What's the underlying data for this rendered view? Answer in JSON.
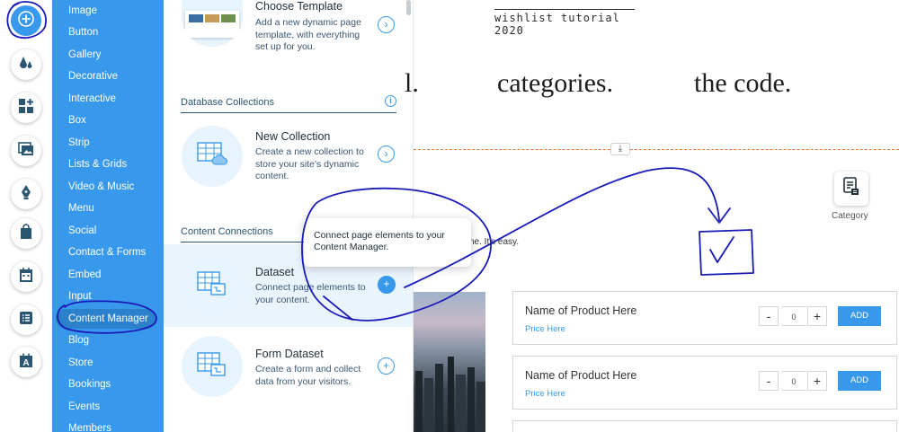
{
  "rail": {
    "buttons": [
      "add-icon",
      "theme-icon",
      "apps-icon",
      "media-icon",
      "pen-icon",
      "store-bag-icon",
      "calendar-icon",
      "list-icon",
      "text-icon"
    ]
  },
  "categories": {
    "items": [
      "Image",
      "Button",
      "Gallery",
      "Decorative",
      "Interactive",
      "Box",
      "Strip",
      "Lists & Grids",
      "Video & Music",
      "Menu",
      "Social",
      "Contact & Forms",
      "Embed",
      "Input",
      "Content Manager",
      "Blog",
      "Store",
      "Bookings",
      "Events",
      "Members"
    ],
    "selected": "Content Manager"
  },
  "panel": {
    "choose_template": {
      "title": "Choose Template",
      "desc": "Add a new dynamic page template, with everything set up for you."
    },
    "database_collections_title": "Database Collections",
    "new_collection": {
      "title": "New Collection",
      "desc": "Create a new collection to store your site's dynamic content."
    },
    "content_connections_title": "Content Connections",
    "dataset": {
      "title": "Dataset",
      "desc": "Connect page elements to your content."
    },
    "form_dataset": {
      "title": "Form Dataset",
      "desc": "Create a form and collect data from your visitors."
    },
    "tooltip": "Connect page elements to your Content Manager."
  },
  "canvas": {
    "header": "wishlist tutorial 2020",
    "big_words": [
      "l.",
      "categories.",
      "the code."
    ],
    "category_label": "Category",
    "easy_text": "ne. It's easy.",
    "products": [
      {
        "name": "Name of Product Here",
        "price": "Price Here",
        "qty": "0",
        "add": "ADD"
      },
      {
        "name": "Name of Product Here",
        "price": "Price Here",
        "qty": "0",
        "add": "ADD"
      }
    ]
  },
  "colors": {
    "accent": "#3899ec",
    "accent_dark": "#2b81cb",
    "strip_line": "#e8772e",
    "annotation_ink": "#1a1ab8"
  }
}
